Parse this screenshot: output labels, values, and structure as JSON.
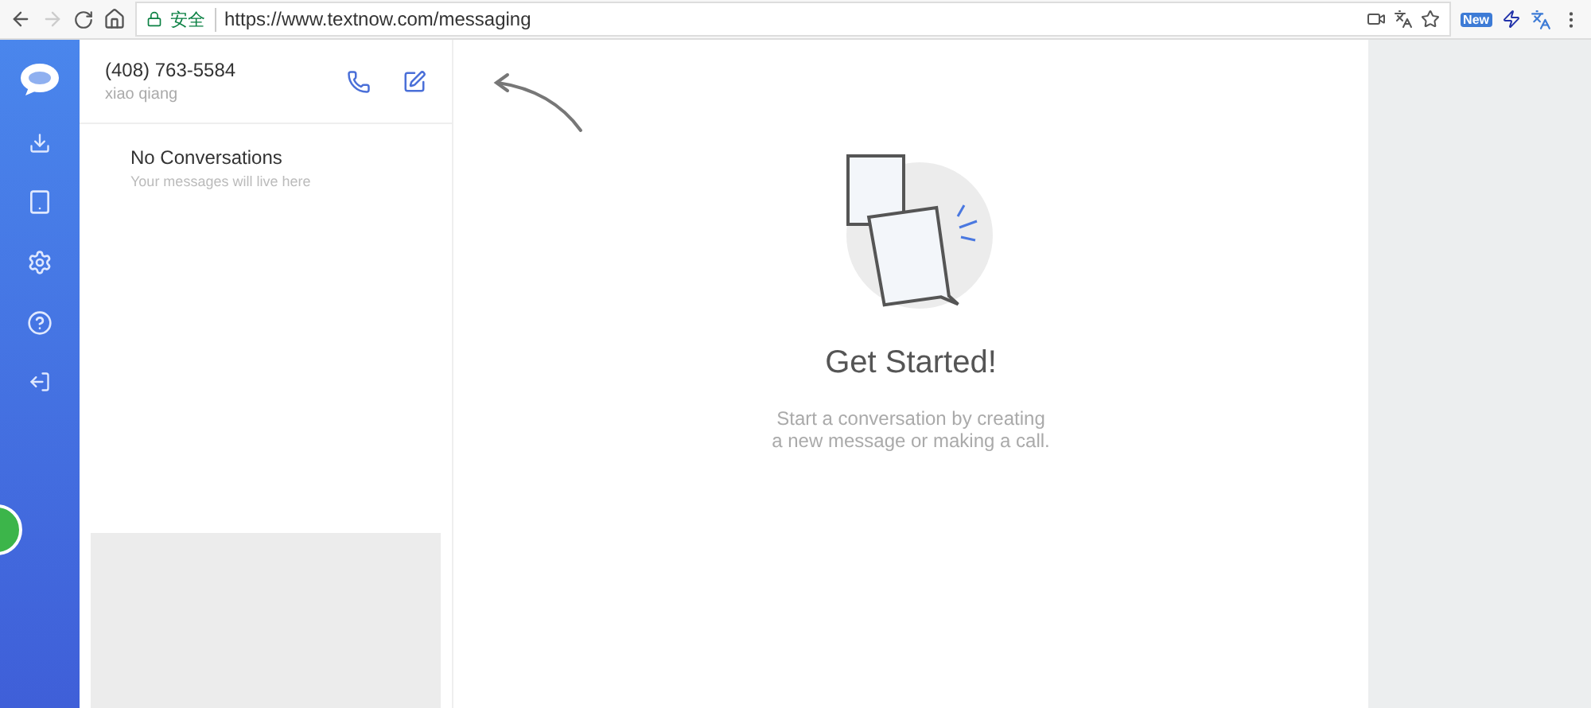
{
  "browser": {
    "secure_label": "安全",
    "url": "https://www.textnow.com/messaging",
    "extension_badge": "New"
  },
  "account": {
    "phone": "(408) 763-5584",
    "name": "xiao qiang"
  },
  "conversations": {
    "title": "No Conversations",
    "subtitle": "Your messages will live here"
  },
  "empty_state": {
    "title": "Get Started!",
    "message": "Start a conversation by creating\na new message or making a call."
  }
}
